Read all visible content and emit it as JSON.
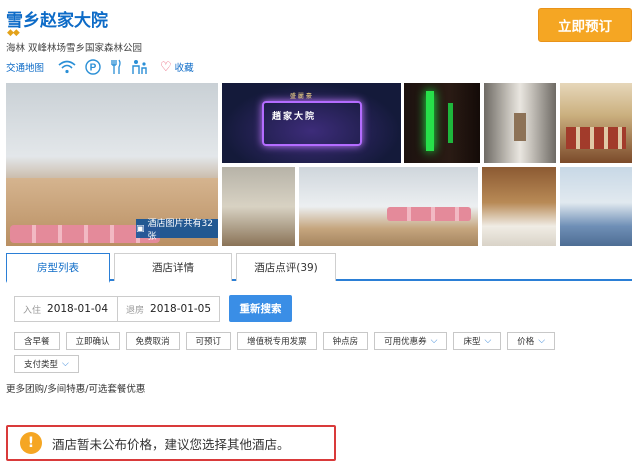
{
  "hotel": {
    "name": "雪乡赵家大院",
    "stars": "◆◆",
    "address": "海林 双峰林场雪乡国家森林公园",
    "book_label": "立即预订"
  },
  "facilities": {
    "map_label": "交通地图",
    "icons": [
      "wifi-icon",
      "parking-icon",
      "restaurant-icon",
      "family-icon"
    ],
    "favorite_label": "收藏"
  },
  "gallery": {
    "badge_label": "酒店图片共有32张",
    "night_sign": "趙家大院",
    "night_sign_top": "盛 麗 豪"
  },
  "tabs": [
    {
      "label": "房型列表",
      "active": true
    },
    {
      "label": "酒店详情",
      "active": false
    },
    {
      "label": "酒店点评(39)",
      "active": false
    }
  ],
  "search": {
    "checkin_label": "入住",
    "checkin_value": "2018-01-04",
    "checkout_label": "退房",
    "checkout_value": "2018-01-05",
    "button_label": "重新搜索"
  },
  "filters": [
    {
      "label": "含早餐",
      "dropdown": false
    },
    {
      "label": "立即确认",
      "dropdown": false
    },
    {
      "label": "免费取消",
      "dropdown": false
    },
    {
      "label": "可预订",
      "dropdown": false
    },
    {
      "label": "增值税专用发票",
      "dropdown": false
    },
    {
      "label": "钟点房",
      "dropdown": false
    },
    {
      "label": "可用优惠券",
      "dropdown": true
    },
    {
      "label": "床型",
      "dropdown": true
    },
    {
      "label": "价格",
      "dropdown": true
    },
    {
      "label": "支付类型",
      "dropdown": true
    }
  ],
  "promo_text": "更多团购/多间特惠/可选套餐优惠",
  "notice": {
    "icon": "!",
    "text": "酒店暂未公布价格，建议您选择其他酒店。"
  },
  "colors": {
    "brand_blue": "#0d6bc7",
    "book_orange": "#f5a623",
    "notice_red": "#d93a3a"
  }
}
